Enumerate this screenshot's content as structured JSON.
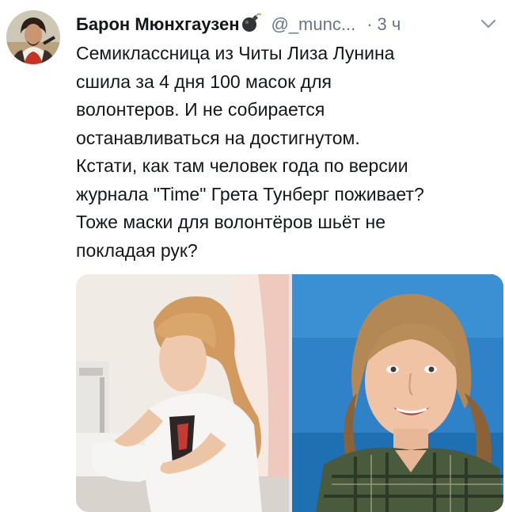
{
  "tweet": {
    "display_name": "Барон Мюнхгаузен",
    "name_emoji_icon": "bomb-icon",
    "handle": "@_munc...",
    "separator": "·",
    "time": "3 ч",
    "menu_icon": "chevron-down-icon",
    "text_lines": [
      "Семиклассница из Читы Лиза Лунина",
      "сшила за 4 дня 100 масок для",
      "волонтеров. И не собирается",
      "останавливаться на достигнутом.",
      "Кстати, как там человек года по версии",
      "журнала \"Time\" Грета Тунберг поживает?",
      "Тоже маски для волонтёров шьёт не",
      "покладая рук?"
    ],
    "media": {
      "images": 2
    }
  },
  "colors": {
    "text": "#14171a",
    "secondary": "#657786",
    "background": "#ffffff"
  }
}
